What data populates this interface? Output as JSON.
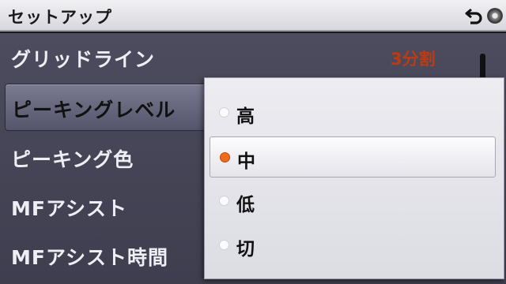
{
  "header": {
    "title": "セットアップ"
  },
  "menu": {
    "items": [
      {
        "label": "グリッドライン",
        "value": "3分割"
      },
      {
        "label": "ピーキングレベル"
      },
      {
        "label": "ピーキング色"
      },
      {
        "label": "MFアシスト"
      },
      {
        "label": "MFアシスト時間"
      }
    ]
  },
  "popup": {
    "options": [
      {
        "label": "高",
        "selected": false
      },
      {
        "label": "中",
        "selected": true
      },
      {
        "label": "低",
        "selected": false
      },
      {
        "label": "切",
        "selected": false
      }
    ]
  },
  "colors": {
    "value_text": "#c03a10",
    "selected_radio": "#ef6a1a"
  },
  "icons": [
    "back-icon",
    "disc-icon"
  ]
}
